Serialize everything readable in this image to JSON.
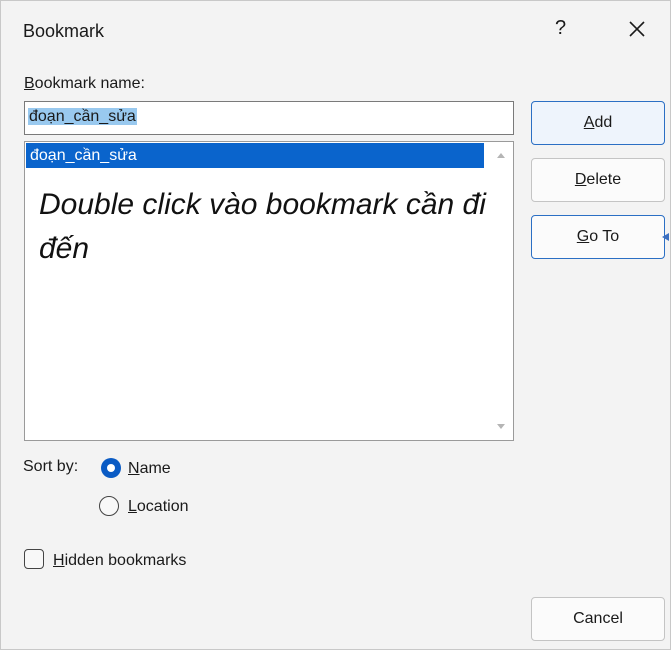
{
  "dialog": {
    "title": "Bookmark",
    "help": "?"
  },
  "bookmark_name": {
    "label_underlined": "B",
    "label_rest": "ookmark name:",
    "value": "đoạn_cần_sửa"
  },
  "bookmark_list": {
    "items": [
      "đoạn_cần_sửa"
    ]
  },
  "annotation": "Double click vào bookmark cần đi đến",
  "buttons": {
    "add": {
      "u": "A",
      "rest": "dd"
    },
    "delete": {
      "u": "D",
      "rest": "elete"
    },
    "goto": {
      "u": "G",
      "rest": "o To"
    },
    "cancel": "Cancel"
  },
  "sort": {
    "label": "Sort by:",
    "name": {
      "u": "N",
      "rest": "ame",
      "selected": true
    },
    "location": {
      "u": "L",
      "rest": "ocation",
      "selected": false
    }
  },
  "hidden": {
    "u": "H",
    "rest": "idden bookmarks",
    "checked": false
  },
  "colors": {
    "selection": "#0a64cc",
    "text_highlight": "#99c9ef",
    "accent_border": "#2b6fc4"
  }
}
